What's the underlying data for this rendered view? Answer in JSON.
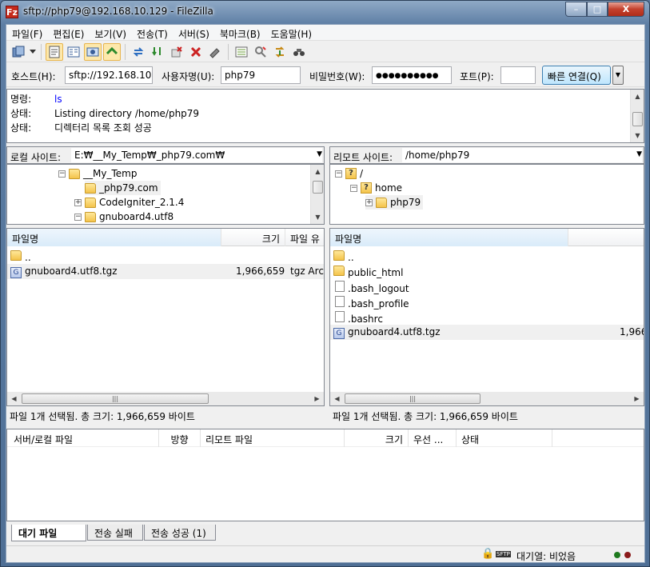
{
  "window": {
    "title": "sftp://php79@192.168.10.129 - FileZilla",
    "app_icon": "Fz",
    "buttons": {
      "minimize": "–",
      "maximize": "□",
      "close": "X"
    }
  },
  "menu": [
    "파일(F)",
    "편집(E)",
    "보기(V)",
    "전송(T)",
    "서버(S)",
    "북마크(B)",
    "도움말(H)"
  ],
  "toolbar": {
    "icons": [
      "site-manager-icon",
      "dropdown-arrow-icon",
      "toggle-log-icon",
      "toggle-tree-local-icon",
      "toggle-tree-remote-icon",
      "toggle-queue-icon",
      "refresh-icon",
      "process-queue-icon",
      "stop-icon",
      "disconnect-icon",
      "reconnect-icon",
      "filter-icon",
      "compare-icon",
      "sync-browse-icon",
      "search-icon"
    ]
  },
  "quickconnect": {
    "host_label": "호스트(H):",
    "host_value": "sftp://192.168.10.",
    "user_label": "사용자명(U):",
    "user_value": "php79",
    "pass_label": "비밀번호(W):",
    "pass_value": "●●●●●●●●●●",
    "port_label": "포트(P):",
    "port_value": "",
    "connect_label": "빠른 연결(Q)",
    "dropdown": "▼"
  },
  "log": [
    {
      "key": "명령:",
      "value": "ls",
      "type": "cmd"
    },
    {
      "key": "상태:",
      "value": "Listing directory /home/php79",
      "type": "status"
    },
    {
      "key": "상태:",
      "value": "디렉터리 목록 조회 성공",
      "type": "status"
    }
  ],
  "local": {
    "site_label": "로컬 사이트:",
    "path": "E:₩__My_Temp₩_php79.com₩",
    "tree": [
      {
        "expander": "−",
        "name": "__My_Temp"
      },
      {
        "expander": "",
        "name": "_php79.com"
      },
      {
        "expander": "+",
        "name": "CodeIgniter_2.1.4"
      },
      {
        "expander": "−",
        "name": "gnuboard4.utf8"
      }
    ],
    "columns": [
      "파일명",
      "크기",
      "파일 유"
    ],
    "files": [
      {
        "name": "..",
        "size": "",
        "type": "",
        "icon": "folder"
      },
      {
        "name": "gnuboard4.utf8.tgz",
        "size": "1,966,659",
        "type": "tgz Arch",
        "icon": "tgz"
      }
    ],
    "scroll_grip": "|||",
    "status": "파일 1개 선택됨. 총 크기: 1,966,659 바이트"
  },
  "remote": {
    "site_label": "리모트 사이트:",
    "path": "/home/php79",
    "tree": [
      {
        "expander": "−",
        "name": "/"
      },
      {
        "expander": "−",
        "name": "home"
      },
      {
        "expander": "+",
        "name": "php79"
      }
    ],
    "unknown_marker": "?",
    "columns": [
      "파일명"
    ],
    "files": [
      {
        "name": "..",
        "size": "",
        "icon": "folder"
      },
      {
        "name": "public_html",
        "size": "",
        "icon": "folder"
      },
      {
        "name": ".bash_logout",
        "size": "",
        "icon": "file"
      },
      {
        "name": ".bash_profile",
        "size": "",
        "icon": "file"
      },
      {
        "name": ".bashrc",
        "size": "",
        "icon": "file"
      },
      {
        "name": "gnuboard4.utf8.tgz",
        "size": "1,966",
        "icon": "tgz"
      }
    ],
    "scroll_grip": "|||",
    "status": "파일 1개 선택됨. 총 크기: 1,966,659 바이트"
  },
  "queue": {
    "columns": [
      "서버/로컬 파일",
      "방향",
      "리모트 파일",
      "크기",
      "우선 ...",
      "상태"
    ]
  },
  "tabs": [
    "대기 파일",
    "전송 실패",
    "전송 성공 (1)"
  ],
  "statusbar": {
    "lock": "🔒",
    "proto": "SFTP",
    "queue_text": "대기열: 비었음",
    "indicator_colors": [
      "#1e7a1e",
      "#8a1a1a"
    ]
  },
  "scroll": {
    "up": "▲",
    "down": "▼",
    "left": "◀",
    "right": "▶"
  },
  "sort_arrow": "^",
  "tree_connector_open": "−",
  "tgz_glyph": "G"
}
